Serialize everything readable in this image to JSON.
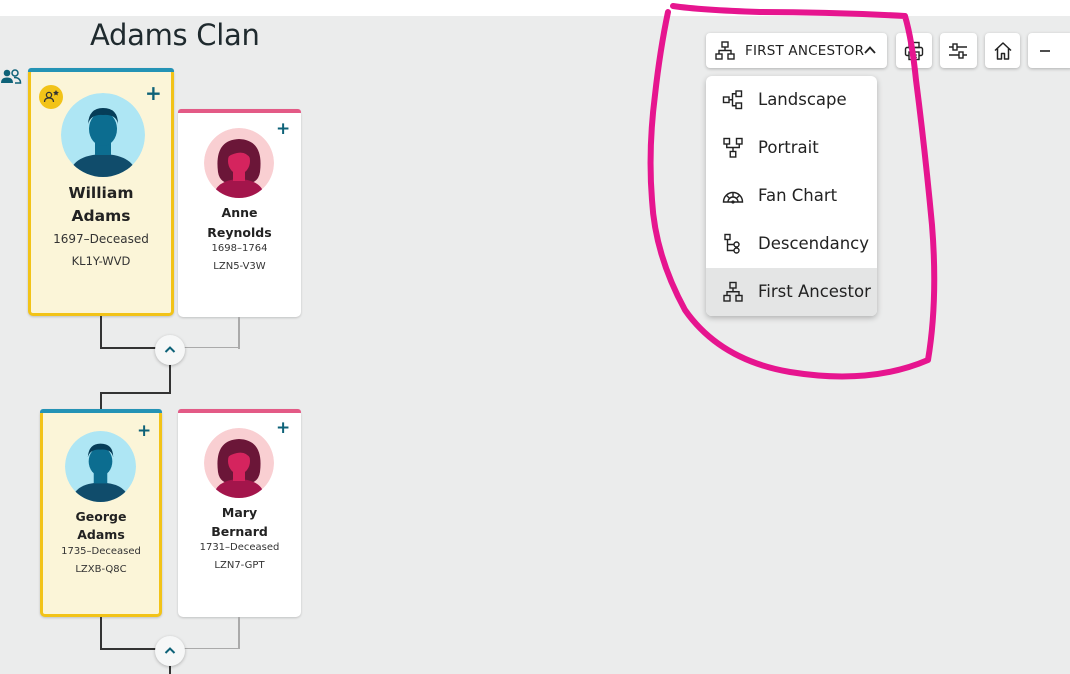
{
  "header": {
    "title": "Adams Clan"
  },
  "toolbar": {
    "view_label": "FIRST ANCESTOR",
    "view_options": [
      {
        "label": "Landscape",
        "icon": "landscape-icon"
      },
      {
        "label": "Portrait",
        "icon": "portrait-icon"
      },
      {
        "label": "Fan Chart",
        "icon": "fan-chart-icon"
      },
      {
        "label": "Descendancy",
        "icon": "descendancy-icon"
      },
      {
        "label": "First Ancestor",
        "icon": "first-ancestor-icon",
        "selected": true
      }
    ],
    "buttons": [
      "print-icon",
      "settings-sliders-icon",
      "home-icon",
      "zoom-out-icon"
    ]
  },
  "people": {
    "william": {
      "first": "William",
      "last": "Adams",
      "dates": "1697–Deceased",
      "id": "KL1Y-WVD"
    },
    "anne": {
      "first": "Anne",
      "last": "Reynolds",
      "dates": "1698–1764",
      "id": "LZN5-V3W"
    },
    "george": {
      "first": "George",
      "last": "Adams",
      "dates": "1735–Deceased",
      "id": "LZXB-Q8C"
    },
    "mary": {
      "first": "Mary",
      "last": "Bernard",
      "dates": "1731–Deceased",
      "id": "LZN7-GPT"
    }
  },
  "colors": {
    "male_border": "#f2c318",
    "male_topbar": "#2493b5",
    "female_topbar": "#e35a86",
    "accent": "#0e6278",
    "annotation": "#e6158f"
  }
}
